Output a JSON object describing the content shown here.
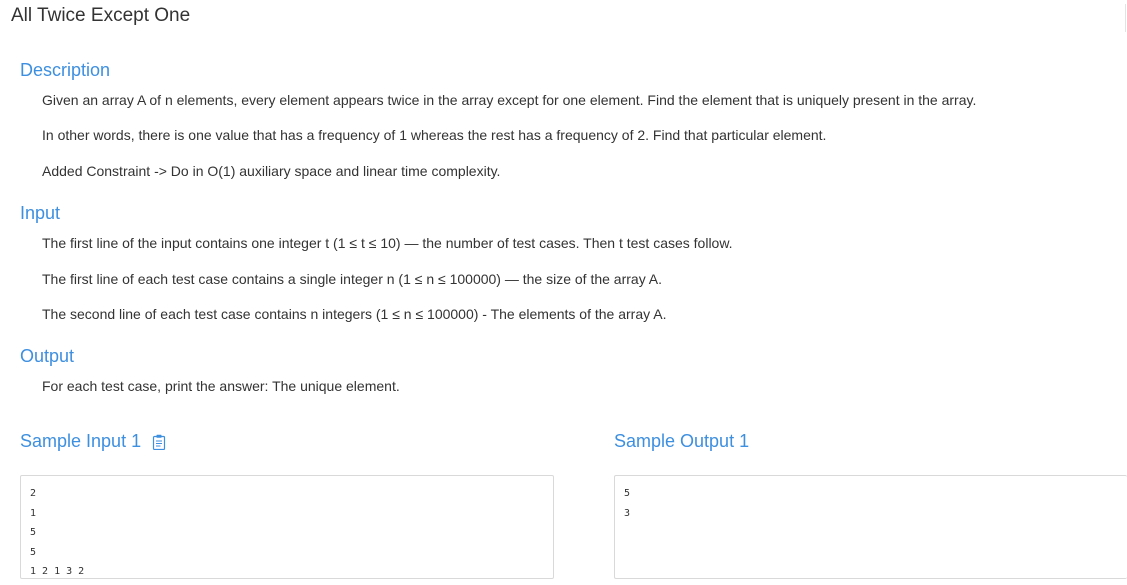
{
  "problem": {
    "title": "All Twice Except One"
  },
  "sections": {
    "description": {
      "heading": "Description",
      "paragraphs": [
        "Given an array A of n elements, every element appears twice in the array except for one element. Find the element that is uniquely present in the array.",
        "In other words, there is one value that has a frequency of 1 whereas the rest has a frequency of 2. Find that particular element.",
        "Added Constraint -> Do in O(1) auxiliary space and linear time complexity."
      ]
    },
    "input": {
      "heading": "Input",
      "paragraphs": [
        "The first line of the input contains one integer t (1 ≤ t ≤ 10) — the number of test cases. Then t test cases follow.",
        "The first line of each test case contains a single integer n (1 ≤ n ≤ 100000) — the size of the array A.",
        "The second line of each test case contains n integers (1 ≤ n ≤ 100000) - The elements of the array A."
      ]
    },
    "output": {
      "heading": "Output",
      "paragraphs": [
        "For each test case, print the answer: The unique element."
      ]
    }
  },
  "samples": {
    "input": {
      "heading": "Sample Input 1",
      "copy_icon": "clipboard-icon",
      "content": "2\n1\n5\n5\n1 2 1 3 2"
    },
    "output": {
      "heading": "Sample Output 1",
      "content": "5\n3"
    }
  },
  "colors": {
    "heading": "#3d8fe0",
    "text": "#333333",
    "border": "#d9d9d9"
  }
}
